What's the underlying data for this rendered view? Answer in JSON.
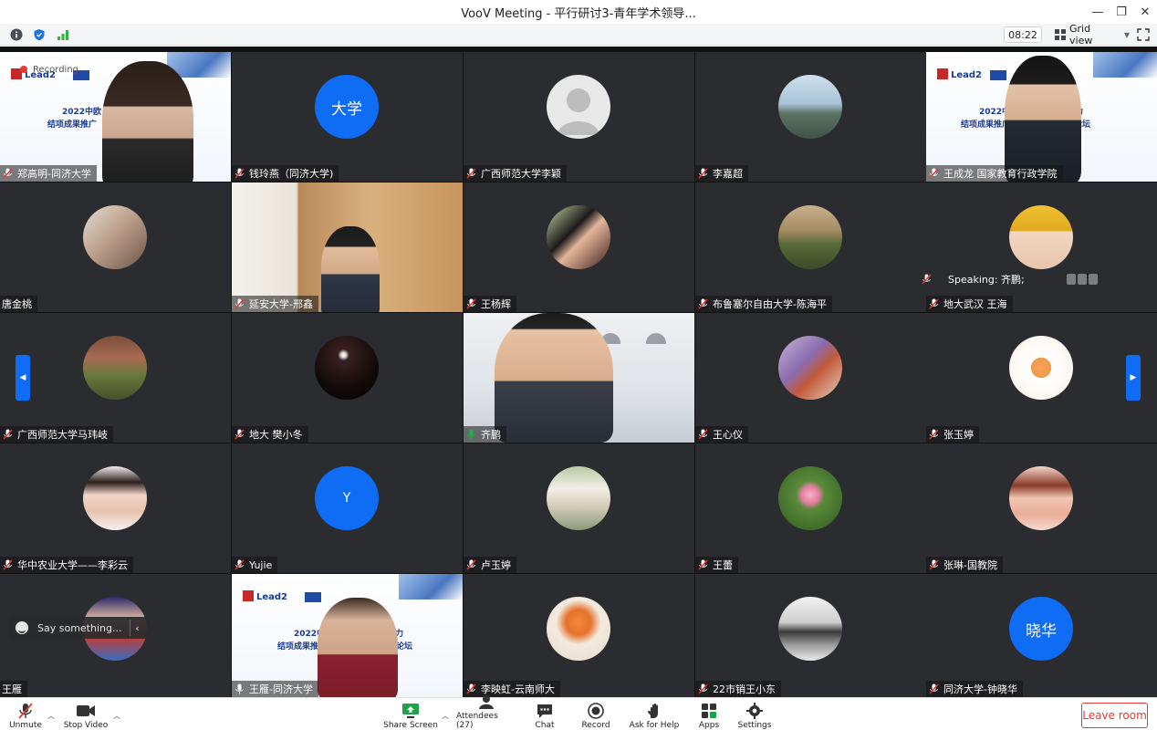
{
  "window": {
    "title": "VooV Meeting - 平行研讨3-青年学术领导...",
    "minimize_glyph": "—",
    "restore_glyph": "❐",
    "close_glyph": "✕"
  },
  "toolbar": {
    "timer": "08:22",
    "view_label": "Grid view",
    "icons": [
      "info-icon",
      "shield-icon",
      "signal-icon"
    ]
  },
  "recording": {
    "label": "Recording"
  },
  "speaking": {
    "label": "Speaking: 齐鹏;"
  },
  "chat_box": {
    "placeholder": "Say something..."
  },
  "tiles": [
    {
      "name": "郑高明-同济大学"
    },
    {
      "name": "钱玲燕（同济大学)",
      "avatar_text": "大学"
    },
    {
      "name": "广西师范大学李颖"
    },
    {
      "name": "李嘉超"
    },
    {
      "name": "王成龙 国家教育行政学院"
    },
    {
      "name": "唐金桃"
    },
    {
      "name": "延安大学-邢鑫"
    },
    {
      "name": "王杨辉"
    },
    {
      "name": "布鲁塞尔自由大学-陈海平"
    },
    {
      "name": "地大武汉 王海"
    },
    {
      "name": "广西师范大学马玮岐"
    },
    {
      "name": "地大 樊小冬"
    },
    {
      "name": "齐鹏"
    },
    {
      "name": "王心仪"
    },
    {
      "name": "张玉婷"
    },
    {
      "name": "华中农业大学——李彩云"
    },
    {
      "name": "Yujie",
      "avatar_text": "Y"
    },
    {
      "name": "卢玉婷"
    },
    {
      "name": "王蕾"
    },
    {
      "name": "张琳-国教院"
    },
    {
      "name": "王雁"
    },
    {
      "name": "王雁-同济大学"
    },
    {
      "name": "李映虹-云南师大"
    },
    {
      "name": "22市销王小东"
    },
    {
      "name": "同济大学-钟晓华",
      "avatar_text": "晓华"
    }
  ],
  "slides": {
    "brand": "Lead2",
    "line1": "2022中欧",
    "line1b": "术领导力",
    "line2": "结项成果推广",
    "line2b": "导力论坛",
    "line1_full_a": "2022中",
    "line1_full_b": "术领导力",
    "line2_full_a": "结项成果推广",
    "line2_full_b": "术领导力论坛"
  },
  "controls": {
    "unmute": "Unmute",
    "stop_video": "Stop Video",
    "share_screen": "Share Screen",
    "attendees": "Attendees (27)",
    "chat": "Chat",
    "record": "Record",
    "ask_help": "Ask for Help",
    "apps": "Apps",
    "settings": "Settings",
    "leave": "Leave room"
  },
  "colors": {
    "accent": "#0f6cf5",
    "leave": "#e53935",
    "speaking_border": "#1fb33f",
    "tile_bg": "#2a2c2f"
  }
}
